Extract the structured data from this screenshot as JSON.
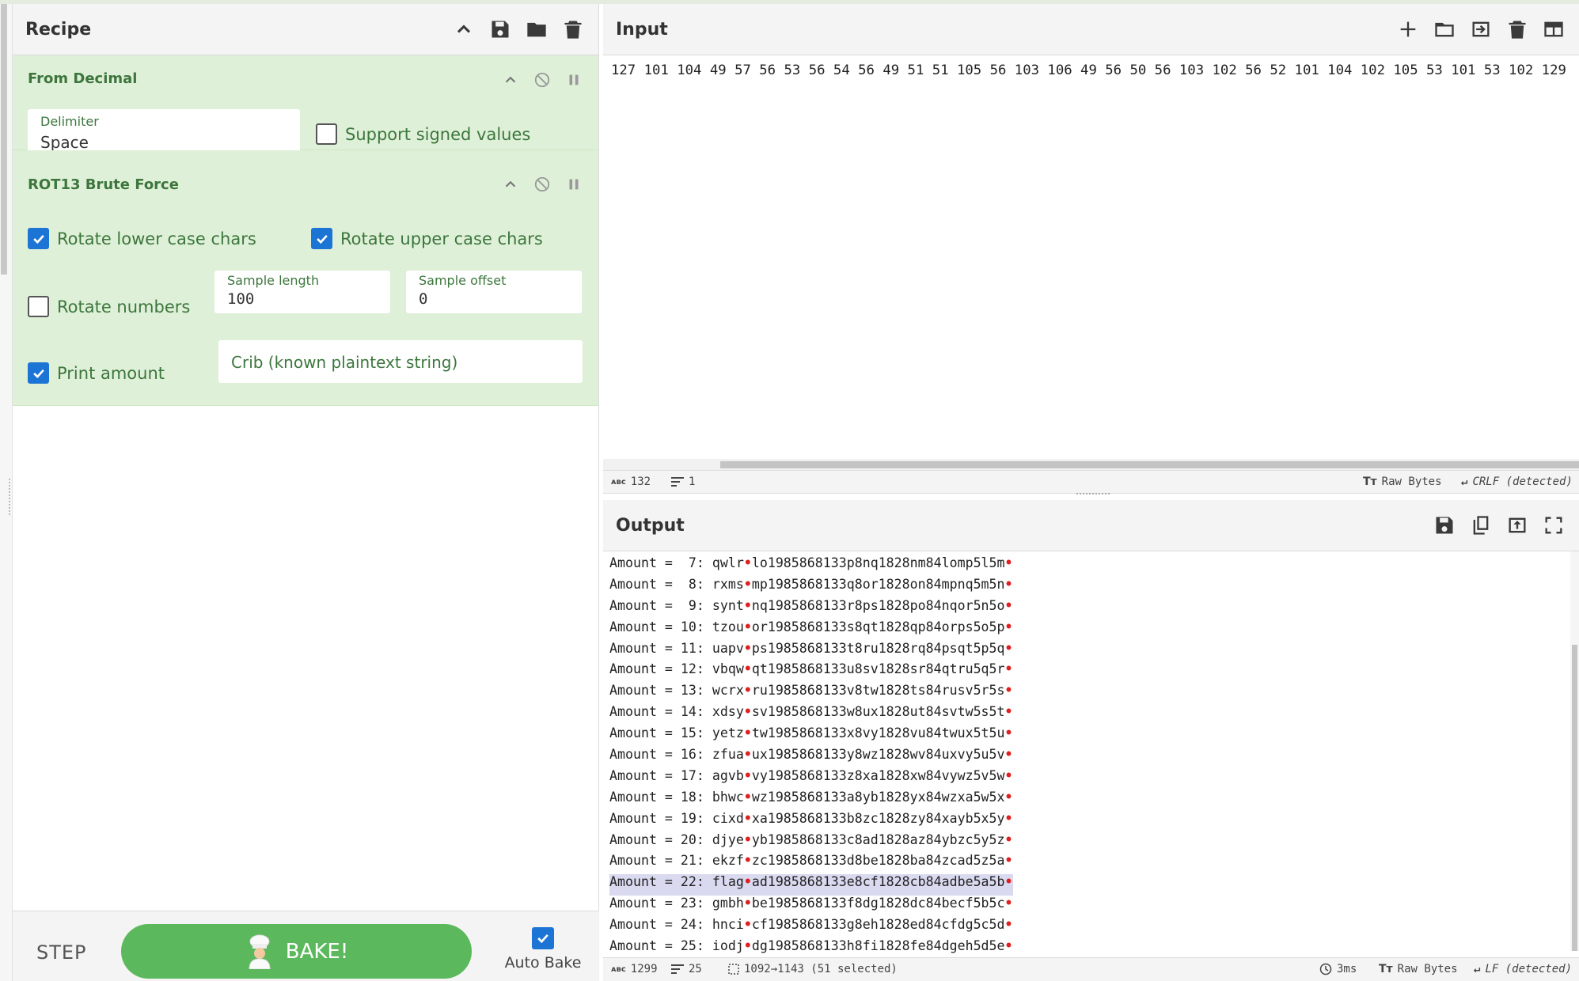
{
  "recipe": {
    "title": "Recipe",
    "ops": [
      {
        "title": "From Decimal",
        "delimiter_label": "Delimiter",
        "delimiter_value": "Space",
        "signed_label": "Support signed values"
      },
      {
        "title": "ROT13 Brute Force",
        "lower_label": "Rotate lower case chars",
        "upper_label": "Rotate upper case chars",
        "numbers_label": "Rotate numbers",
        "sample_length_label": "Sample length",
        "sample_length_value": "100",
        "sample_offset_label": "Sample offset",
        "sample_offset_value": "0",
        "print_amount_label": "Print amount",
        "crib_placeholder": "Crib (known plaintext string)"
      }
    ],
    "step_label": "STEP",
    "bake_label": "BAKE!",
    "autobake_label": "Auto Bake"
  },
  "input": {
    "title": "Input",
    "text": "127 101 104 49 57 56 53 56 54 56 49 51 51 105 56 103 106 49 56 50 56 103 102 56 52 101 104 102 105 53 101 53 102 129",
    "status": {
      "chars": "132",
      "lines": "1",
      "encoding": "Raw Bytes",
      "eol": "CRLF (detected)"
    }
  },
  "output": {
    "title": "Output",
    "lines": [
      {
        "prefix": "Amount =  7: qwlr",
        "rest": "lo1985868133p8nq1828nm84lomp5l5m"
      },
      {
        "prefix": "Amount =  8: rxms",
        "rest": "mp1985868133q8or1828on84mpnq5m5n"
      },
      {
        "prefix": "Amount =  9: synt",
        "rest": "nq1985868133r8ps1828po84nqor5n5o"
      },
      {
        "prefix": "Amount = 10: tzou",
        "rest": "or1985868133s8qt1828qp84orps5o5p"
      },
      {
        "prefix": "Amount = 11: uapv",
        "rest": "ps1985868133t8ru1828rq84psqt5p5q"
      },
      {
        "prefix": "Amount = 12: vbqw",
        "rest": "qt1985868133u8sv1828sr84qtru5q5r"
      },
      {
        "prefix": "Amount = 13: wcrx",
        "rest": "ru1985868133v8tw1828ts84rusv5r5s"
      },
      {
        "prefix": "Amount = 14: xdsy",
        "rest": "sv1985868133w8ux1828ut84svtw5s5t"
      },
      {
        "prefix": "Amount = 15: yetz",
        "rest": "tw1985868133x8vy1828vu84twux5t5u"
      },
      {
        "prefix": "Amount = 16: zfua",
        "rest": "ux1985868133y8wz1828wv84uxvy5u5v"
      },
      {
        "prefix": "Amount = 17: agvb",
        "rest": "vy1985868133z8xa1828xw84vywz5v5w"
      },
      {
        "prefix": "Amount = 18: bhwc",
        "rest": "wz1985868133a8yb1828yx84wzxa5w5x"
      },
      {
        "prefix": "Amount = 19: cixd",
        "rest": "xa1985868133b8zc1828zy84xayb5x5y"
      },
      {
        "prefix": "Amount = 20: djye",
        "rest": "yb1985868133c8ad1828az84ybzc5y5z"
      },
      {
        "prefix": "Amount = 21: ekzf",
        "rest": "zc1985868133d8be1828ba84zcad5z5a"
      },
      {
        "prefix": "Amount = 22: flag",
        "rest": "ad1985868133e8cf1828cb84adbe5a5b"
      },
      {
        "prefix": "Amount = 23: gmbh",
        "rest": "be1985868133f8dg1828dc84becf5b5c"
      },
      {
        "prefix": "Amount = 24: hnci",
        "rest": "cf1985868133g8eh1828ed84cfdg5c5d"
      },
      {
        "prefix": "Amount = 25: iodj",
        "rest": "dg1985868133h8fi1828fe84dgeh5d5e"
      }
    ],
    "status": {
      "chars": "1299",
      "lines": "25",
      "selection": "1092→1143 (51 selected)",
      "time": "3ms",
      "encoding": "Raw Bytes",
      "eol": "LF (detected)"
    }
  },
  "colors": {
    "op_bg": "#dff0d8",
    "op_text": "#3c763d",
    "bake": "#5cb85c",
    "checkbox": "#1c74d4",
    "highlight": "#d9d9f0"
  }
}
